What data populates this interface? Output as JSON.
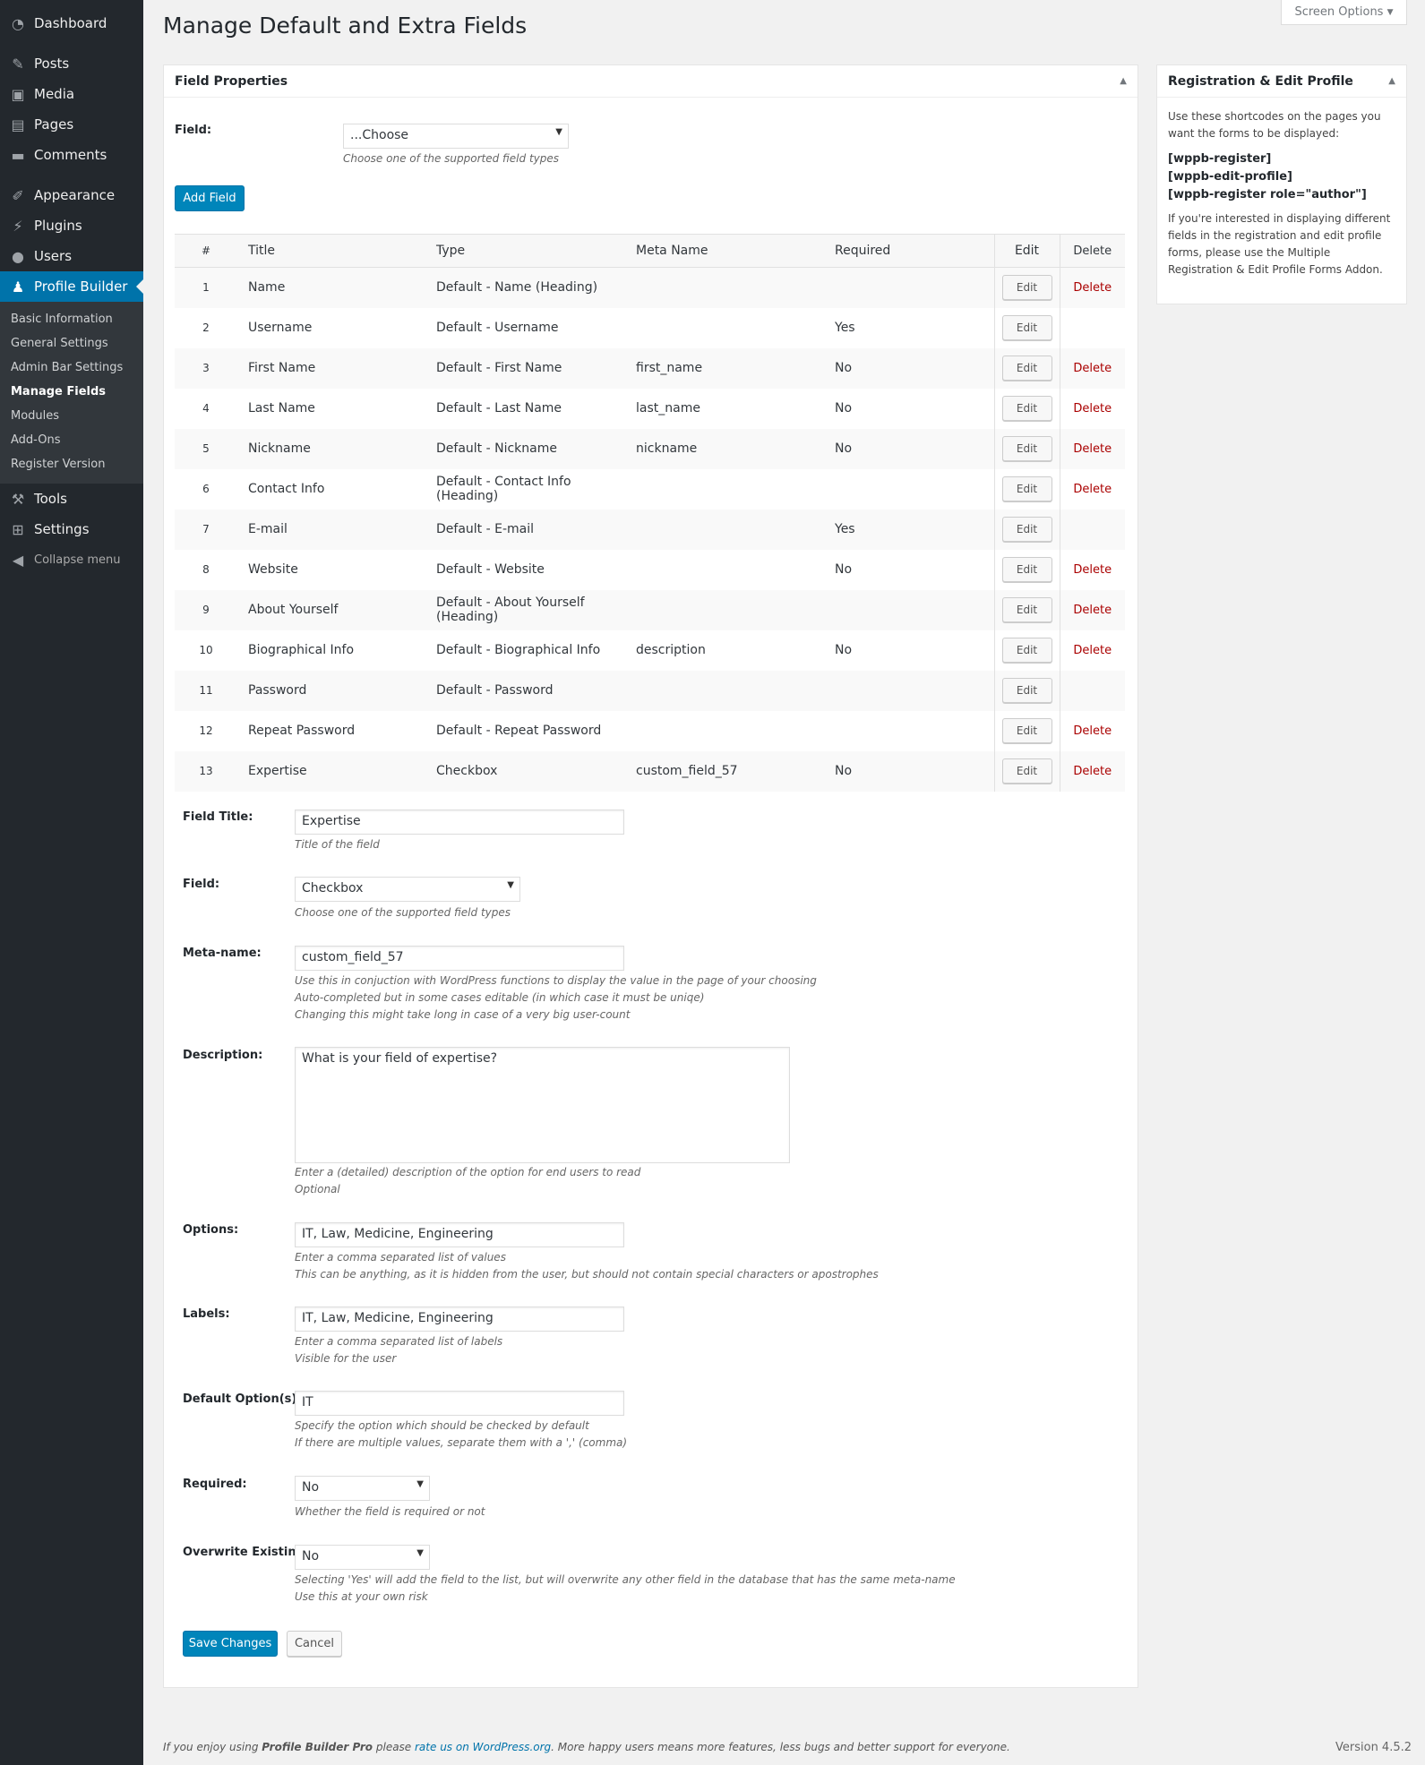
{
  "sidebar": {
    "dashboard": "Dashboard",
    "posts": "Posts",
    "media": "Media",
    "pages": "Pages",
    "comments": "Comments",
    "appearance": "Appearance",
    "plugins": "Plugins",
    "users": "Users",
    "profile_builder": "Profile Builder",
    "submenu": [
      "Basic Information",
      "General Settings",
      "Admin Bar Settings",
      "Manage Fields",
      "Modules",
      "Add-Ons",
      "Register Version"
    ],
    "tools": "Tools",
    "settings": "Settings",
    "collapse": "Collapse menu"
  },
  "screen_options": "Screen Options",
  "page_title": "Manage Default and Extra Fields",
  "field_properties": {
    "title": "Field Properties",
    "field_label": "Field:",
    "field_value": "...Choose",
    "field_hint": "Choose one of the supported field types",
    "add_button": "Add Field"
  },
  "table": {
    "headers": [
      "#",
      "Title",
      "Type",
      "Meta Name",
      "Required",
      "Edit",
      "Delete"
    ],
    "edit_label": "Edit",
    "rows": [
      {
        "num": "1",
        "title": "Name",
        "type": "Default - Name (Heading)",
        "meta": "",
        "required": "",
        "delete": "Delete"
      },
      {
        "num": "2",
        "title": "Username",
        "type": "Default - Username",
        "meta": "",
        "required": "Yes",
        "delete": ""
      },
      {
        "num": "3",
        "title": "First Name",
        "type": "Default - First Name",
        "meta": "first_name",
        "required": "No",
        "delete": "Delete"
      },
      {
        "num": "4",
        "title": "Last Name",
        "type": "Default - Last Name",
        "meta": "last_name",
        "required": "No",
        "delete": "Delete"
      },
      {
        "num": "5",
        "title": "Nickname",
        "type": "Default - Nickname",
        "meta": "nickname",
        "required": "No",
        "delete": "Delete"
      },
      {
        "num": "6",
        "title": "Contact Info",
        "type": "Default - Contact Info (Heading)",
        "meta": "",
        "required": "",
        "delete": "Delete"
      },
      {
        "num": "7",
        "title": "E-mail",
        "type": "Default - E-mail",
        "meta": "",
        "required": "Yes",
        "delete": ""
      },
      {
        "num": "8",
        "title": "Website",
        "type": "Default - Website",
        "meta": "",
        "required": "No",
        "delete": "Delete"
      },
      {
        "num": "9",
        "title": "About Yourself",
        "type": "Default - About Yourself (Heading)",
        "meta": "",
        "required": "",
        "delete": "Delete"
      },
      {
        "num": "10",
        "title": "Biographical Info",
        "type": "Default - Biographical Info",
        "meta": "description",
        "required": "No",
        "delete": "Delete"
      },
      {
        "num": "11",
        "title": "Password",
        "type": "Default - Password",
        "meta": "",
        "required": "",
        "delete": ""
      },
      {
        "num": "12",
        "title": "Repeat Password",
        "type": "Default - Repeat Password",
        "meta": "",
        "required": "",
        "delete": "Delete"
      },
      {
        "num": "13",
        "title": "Expertise",
        "type": "Checkbox",
        "meta": "custom_field_57",
        "required": "No",
        "delete": "Delete"
      }
    ]
  },
  "edit_form": {
    "field_title": {
      "label": "Field Title:",
      "value": "Expertise",
      "hint": "Title of the field"
    },
    "field": {
      "label": "Field:",
      "value": "Checkbox",
      "hint": "Choose one of the supported field types"
    },
    "meta_name": {
      "label": "Meta-name:",
      "value": "custom_field_57",
      "hint1": "Use this in conjuction with WordPress functions to display the value in the page of your choosing",
      "hint2": "Auto-completed but in some cases editable (in which case it must be uniqe)",
      "hint3": "Changing this might take long in case of a very big user-count"
    },
    "description": {
      "label": "Description:",
      "value": "What is your field of expertise?",
      "hint1": "Enter a (detailed) description of the option for end users to read",
      "hint2": "Optional"
    },
    "options": {
      "label": "Options:",
      "value": "IT, Law, Medicine, Engineering",
      "hint1": "Enter a comma separated list of values",
      "hint2": "This can be anything, as it is hidden from the user, but should not contain special characters or apostrophes"
    },
    "labels": {
      "label": "Labels:",
      "value": "IT, Law, Medicine, Engineering",
      "hint1": "Enter a comma separated list of labels",
      "hint2": "Visible for the user"
    },
    "default_options": {
      "label": "Default Option(s):",
      "value": "IT",
      "hint1": "Specify the option which should be checked by default",
      "hint2": "If there are multiple values, separate them with a ',' (comma)"
    },
    "required": {
      "label": "Required:",
      "value": "No",
      "hint": "Whether the field is required or not"
    },
    "overwrite": {
      "label": "Overwrite Existing:",
      "value": "No",
      "hint1": "Selecting 'Yes' will add the field to the list, but will overwrite any other field in the database that has the same meta-name",
      "hint2": "Use this at your own risk"
    },
    "save": "Save Changes",
    "cancel": "Cancel"
  },
  "side_box": {
    "title": "Registration & Edit Profile",
    "intro": "Use these shortcodes on the pages you want the forms to be displayed:",
    "shortcodes": [
      "[wppb-register]",
      "[wppb-edit-profile]",
      "[wppb-register role=\"author\"]"
    ],
    "note": "If you're interested in displaying different fields in the registration and edit profile forms, please use the Multiple Registration & Edit Profile Forms Addon."
  },
  "footer": {
    "pre": "If you enjoy using ",
    "product": "Profile Builder Pro",
    "mid": " please ",
    "link": "rate us on WordPress.org",
    "post": ". More happy users means more features, less bugs and better support for everyone.",
    "version": "Version 4.5.2"
  }
}
